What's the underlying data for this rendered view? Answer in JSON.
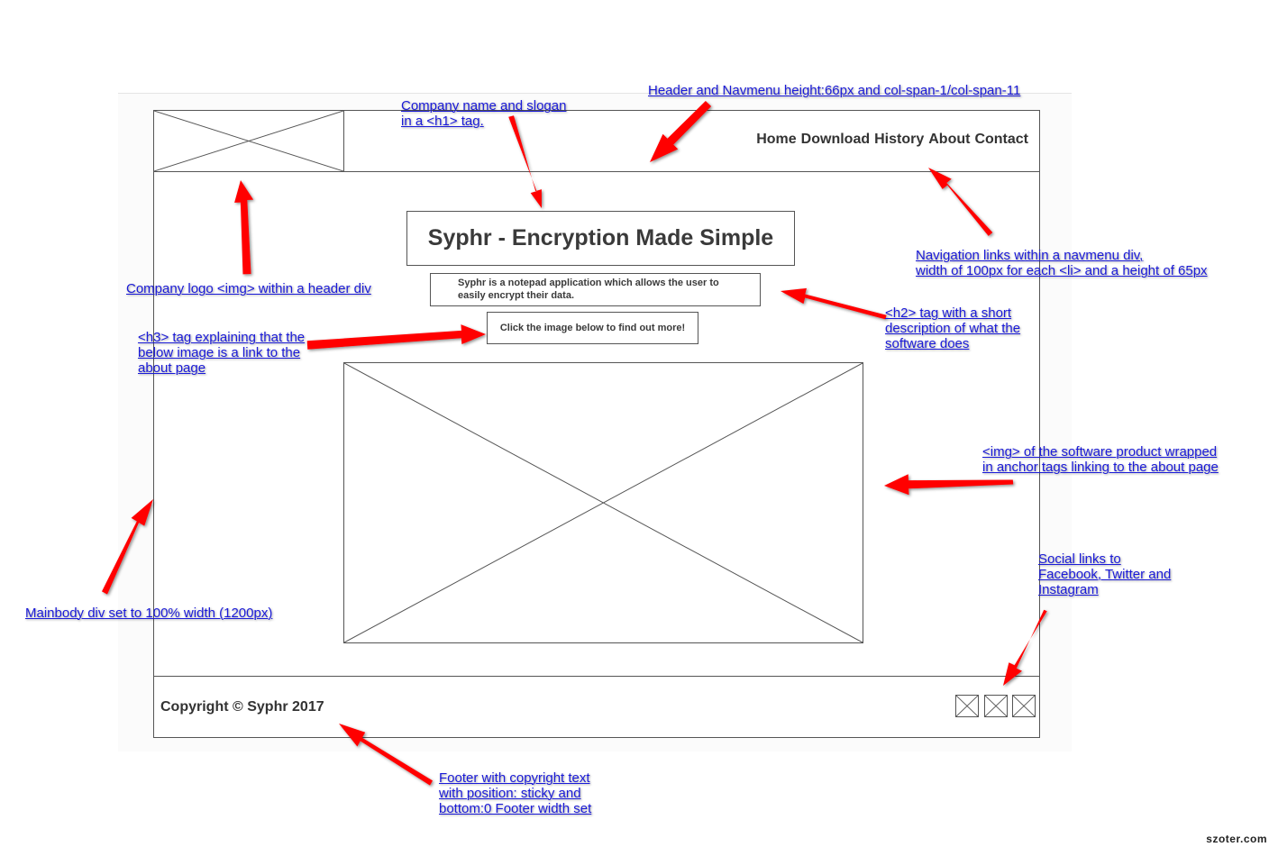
{
  "header": {
    "nav_links": [
      "Home",
      "Download",
      "History",
      "About",
      "Contact"
    ]
  },
  "main": {
    "title": "Syphr - Encryption Made Simple",
    "description_line1": "Syphr is a notepad application which allows the user to",
    "description_line2": "easily encrypt their data.",
    "link_hint": "Click the image below to find out more!"
  },
  "footer": {
    "copyright": "Copyright © Syphr 2017"
  },
  "annotations": {
    "header_height": "Header and Navmenu height:66px and col-span-1/col-span-11",
    "company_name": [
      "Company name and slogan",
      "in a <h1> tag."
    ],
    "logo": "Company logo <img> within a header div",
    "navigation": [
      "Navigation links within a navmenu div,",
      "width of 100px for each <li> and a height of 65px"
    ],
    "h2": [
      "<h2> tag with a short",
      "description of what the",
      "software does"
    ],
    "h3": [
      "<h3> tag explaining that the",
      "below image is a link to the",
      "about page"
    ],
    "img_link": [
      "<img> of the software product wrapped",
      "in anchor tags linking to the about page"
    ],
    "social": [
      "Social links to",
      "Facebook, Twitter and",
      "Instagram"
    ],
    "mainbody": "Mainbody div set to 100% width (1200px)",
    "footer": [
      "Footer with copyright text",
      "with position: sticky and",
      "bottom:0 Footer width set"
    ]
  },
  "colors": {
    "annotation_text": "#1a1ad8",
    "arrow": "#ff0000",
    "wireframe_stroke": "#555555"
  },
  "watermark": "szoter.com"
}
